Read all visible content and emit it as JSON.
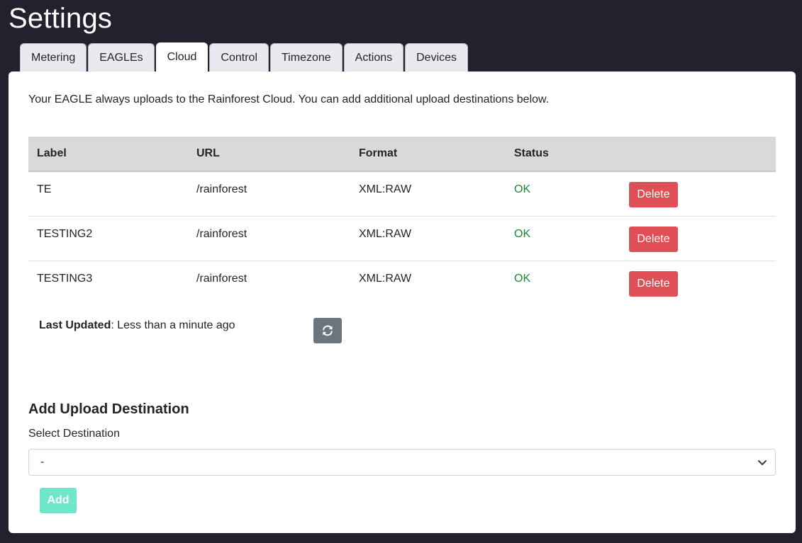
{
  "page_title": "Settings",
  "tabs": [
    {
      "label": "Metering",
      "active": false
    },
    {
      "label": "EAGLEs",
      "active": false
    },
    {
      "label": "Cloud",
      "active": true
    },
    {
      "label": "Control",
      "active": false
    },
    {
      "label": "Timezone",
      "active": false
    },
    {
      "label": "Actions",
      "active": false
    },
    {
      "label": "Devices",
      "active": false
    }
  ],
  "intro": "Your EAGLE always uploads to the Rainforest Cloud. You can add additional upload destinations below.",
  "table": {
    "headers": {
      "label": "Label",
      "url": "URL",
      "format": "Format",
      "status": "Status"
    },
    "rows": [
      {
        "label": "TE",
        "url": "/rainforest",
        "format": "XML:RAW",
        "status": "OK",
        "delete_label": "Delete"
      },
      {
        "label": "TESTING2",
        "url": "/rainforest",
        "format": "XML:RAW",
        "status": "OK",
        "delete_label": "Delete"
      },
      {
        "label": "TESTING3",
        "url": "/rainforest",
        "format": "XML:RAW",
        "status": "OK",
        "delete_label": "Delete"
      }
    ]
  },
  "last_updated": {
    "label": "Last Updated",
    "value": ": Less than a minute ago",
    "refresh_icon": "refresh-icon"
  },
  "add_section": {
    "title": "Add Upload Destination",
    "select_label": "Select Destination",
    "select_value": "-",
    "add_label": "Add"
  },
  "colors": {
    "background": "#22222e",
    "status_ok": "#198a2e",
    "delete_button": "#df4f55",
    "add_button": "#6ee6c9",
    "refresh_button": "#6c757d"
  }
}
